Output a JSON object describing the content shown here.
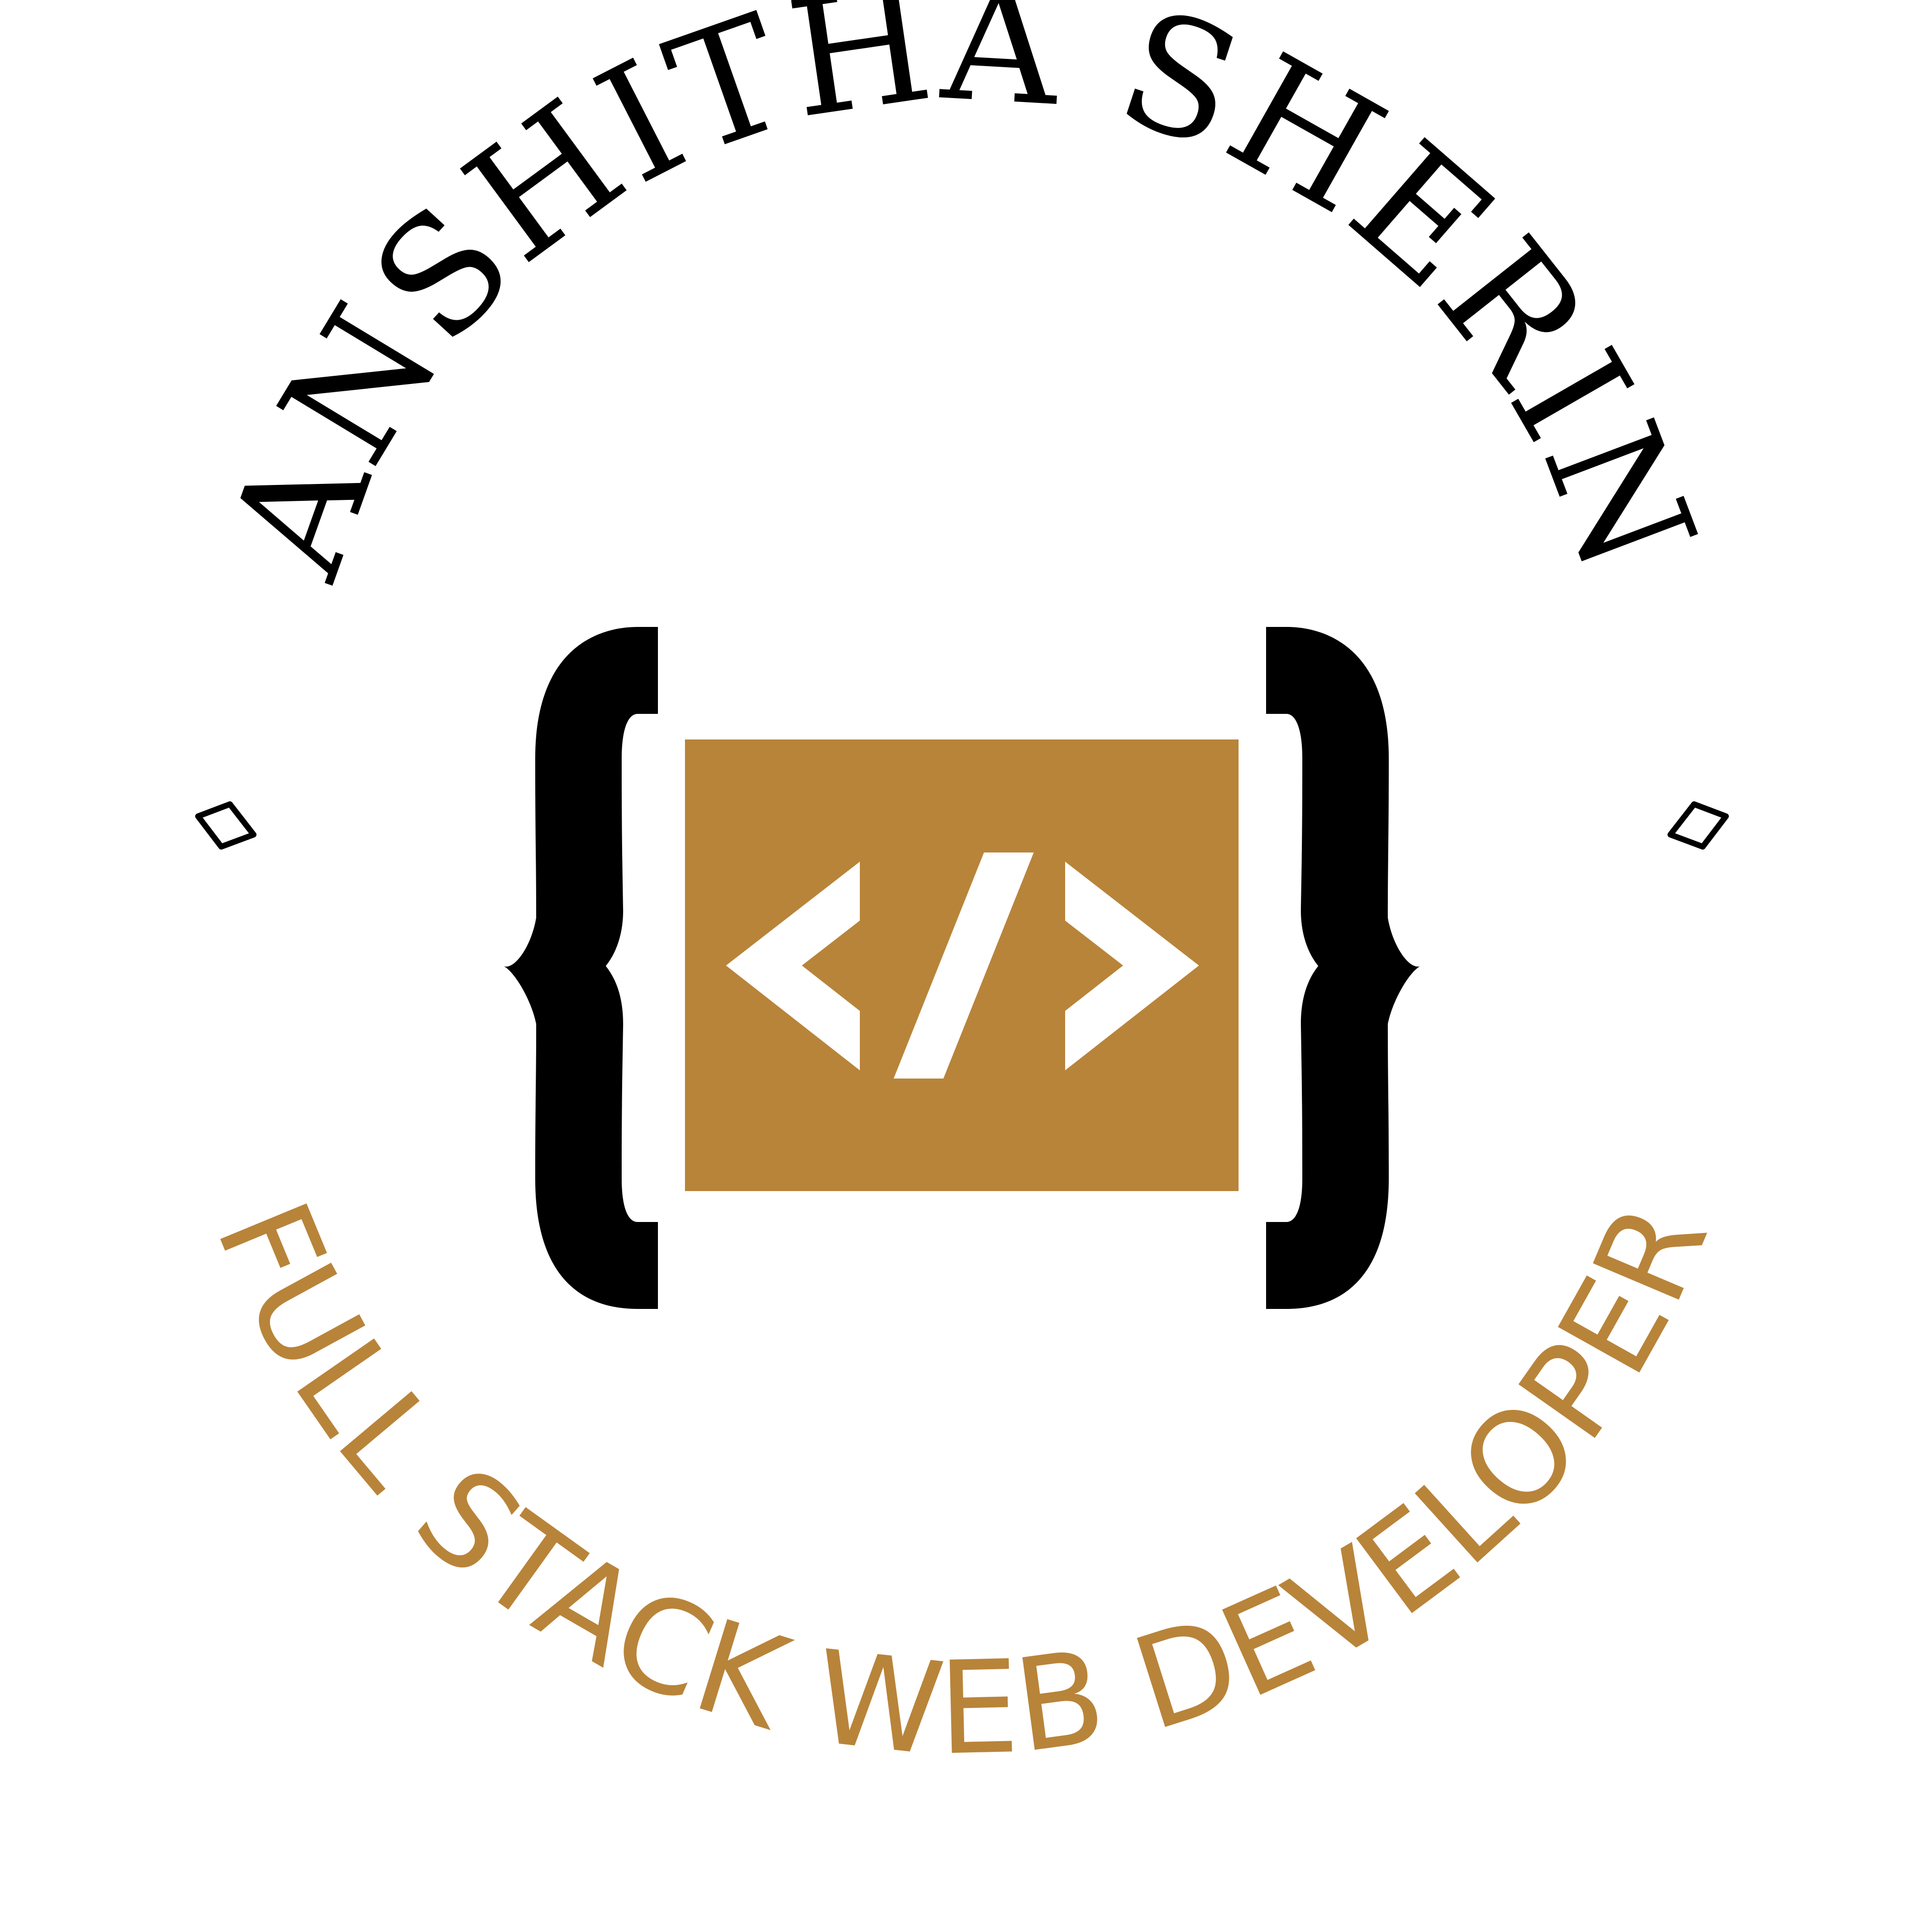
{
  "logo": {
    "name": "ANSHITHA SHERIN",
    "title": "FULL STACK WEB DEVELOPER",
    "center_icon": "code-tag-icon",
    "left_brace_icon": "left-curly-brace-icon",
    "right_brace_icon": "right-curly-brace-icon",
    "ornament_icon": "diamond-ornament-icon"
  },
  "colors": {
    "background": "#ffffff",
    "primary": "#000000",
    "accent": "#b8843a",
    "icon_fg": "#ffffff"
  }
}
